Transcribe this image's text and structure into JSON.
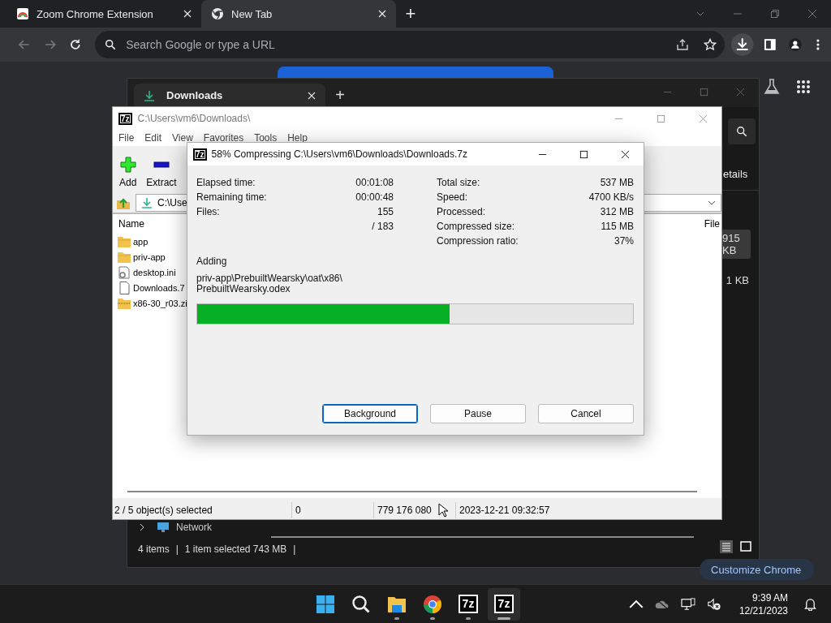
{
  "browser": {
    "tabs": [
      {
        "title": "Zoom Chrome Extension",
        "selected": false,
        "kind": "extension"
      },
      {
        "title": "New Tab",
        "selected": true,
        "kind": "chrome"
      }
    ],
    "new_tab": "+",
    "omnibox": {
      "placeholder": "Search Google or type a URL"
    },
    "customize_button": "Customize Chrome"
  },
  "explorer": {
    "tab": "Downloads",
    "new_tab": "+",
    "details_button": "etails",
    "sizes": [
      "915 KB",
      "1 KB"
    ],
    "nav_item": "Network",
    "status": [
      "4 items",
      "|",
      "1 item selected  743 MB",
      "|"
    ]
  },
  "archiver": {
    "icon_label": "7z",
    "title": "C:\\Users\\vm6\\Downloads\\",
    "menu": [
      "File",
      "Edit",
      "View",
      "Favorites",
      "Tools",
      "Help"
    ],
    "toolbar": [
      {
        "label": "Add",
        "kind": "add"
      },
      {
        "label": "Extract",
        "kind": "extract"
      }
    ],
    "path": "C:\\Use",
    "columns": [
      "Name",
      "File"
    ],
    "files": [
      {
        "name": "app",
        "kind": "folder"
      },
      {
        "name": "priv-app",
        "kind": "folder"
      },
      {
        "name": "desktop.ini",
        "kind": "settings"
      },
      {
        "name": "Downloads.7",
        "kind": "file"
      },
      {
        "name": "x86-30_r03.zi",
        "kind": "zip"
      }
    ],
    "status": [
      "2 / 5 object(s) selected",
      "0",
      "779 176 080",
      "2023-12-21 09:32:57"
    ]
  },
  "dialog": {
    "icon_label": "7z",
    "title": "58% Compressing C:\\Users\\vm6\\Downloads\\Downloads.7z",
    "left_stats": [
      {
        "label": "Elapsed time:",
        "value": "00:01:08"
      },
      {
        "label": "Remaining time:",
        "value": "00:00:48"
      },
      {
        "label": "Files:",
        "value": "155"
      },
      {
        "value": "/ 183"
      }
    ],
    "right_stats": [
      {
        "label": "Total size:",
        "value": "537 MB"
      },
      {
        "label": "Speed:",
        "value": "4700 KB/s"
      },
      {
        "label": "Processed:",
        "value": "312 MB"
      },
      {
        "label": "Compressed size:",
        "value": "115 MB"
      },
      {
        "label": "Compression ratio:",
        "value": "37%"
      }
    ],
    "action": "Adding",
    "current_file": [
      "priv-app\\PrebuiltWearsky\\oat\\x86\\",
      "PrebuiltWearsky.odex"
    ],
    "progress": {
      "level": 0.58
    },
    "buttons": [
      {
        "label": "Background",
        "focused": true
      },
      {
        "label": "Pause",
        "focused": false
      },
      {
        "label": "Cancel",
        "focused": false
      }
    ]
  },
  "taskbar": {
    "apps": [
      {
        "kind": "start",
        "running": false,
        "active": false
      },
      {
        "kind": "search",
        "running": false,
        "active": false
      },
      {
        "kind": "folder",
        "running": true,
        "active": false
      },
      {
        "kind": "chrome",
        "running": true,
        "active": false
      },
      {
        "kind": "archiver",
        "label": "7z",
        "running": true,
        "active": false
      },
      {
        "kind": "archiver",
        "label": "7z",
        "running": true,
        "active": true
      }
    ],
    "clock": {
      "time": "9:39 AM",
      "date": "12/21/2023"
    }
  }
}
